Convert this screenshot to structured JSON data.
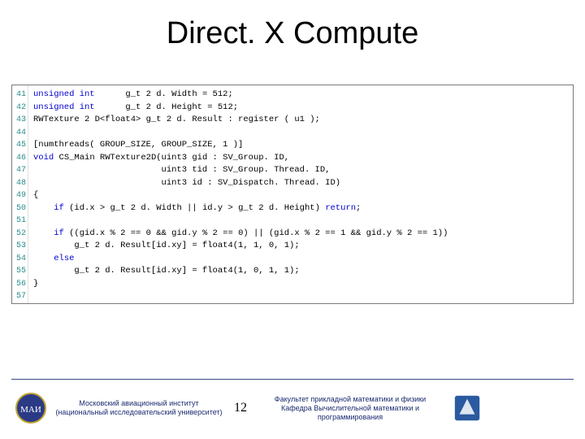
{
  "title": "Direct. X Compute",
  "lineNumbers": [
    "41",
    "42",
    "43",
    "44",
    "45",
    "46",
    "47",
    "48",
    "49",
    "50",
    "51",
    "52",
    "53",
    "54",
    "55",
    "56",
    "57"
  ],
  "code": {
    "l41a": "unsigned int",
    "l41b": "      g_t 2 d. Width = 512;",
    "l42a": "unsigned int",
    "l42b": "      g_t 2 d. Height = 512;",
    "l43": "RWTexture 2 D<float4> g_t 2 d. Result : register ( u1 );",
    "l44": "",
    "l45": "[numthreads( GROUP_SIZE, GROUP_SIZE, 1 )]",
    "l46a": "void",
    "l46b": " CS_Main RWTexture2D(uint3 gid : SV_Group. ID,",
    "l47": "                         uint3 tid : SV_Group. Thread. ID,",
    "l48": "                         uint3 id : SV_Dispatch. Thread. ID)",
    "l49": "{",
    "l50a": "    ",
    "l50b": "if",
    "l50c": " (id.x > g_t 2 d. Width || id.y > g_t 2 d. Height) ",
    "l50d": "return",
    "l50e": ";",
    "l51": "",
    "l52a": "    ",
    "l52b": "if",
    "l52c": " ((gid.x % 2 == 0 && gid.y % 2 == 0) || (gid.x % 2 == 1 && gid.y % 2 == 1))",
    "l53": "        g_t 2 d. Result[id.xy] = float4(1, 1, 0, 1);",
    "l54a": "    ",
    "l54b": "else",
    "l55": "        g_t 2 d. Result[id.xy] = float4(1, 0, 1, 1);",
    "l56": "}",
    "l57": ""
  },
  "footer": {
    "left_line1": "Московский авиационный институт",
    "left_line2": "(национальный исследовательский университет)",
    "page": "12",
    "right_line1": "Факультет прикладной математики и физики",
    "right_line2": "Кафедра Вычислительной математики и",
    "right_line3": "программирования"
  }
}
